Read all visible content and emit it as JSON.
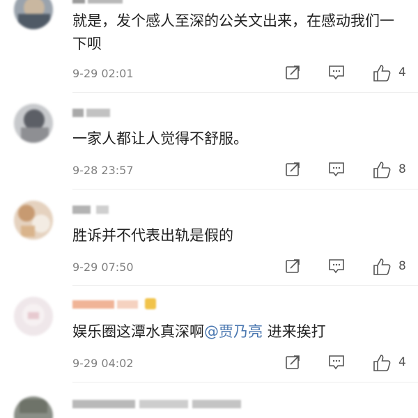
{
  "comments": [
    {
      "text": "就是，发个感人至深的公关文出来，在感动我们一下呗",
      "mention": "",
      "after": "",
      "time": "9-29 02:01",
      "likes": "4"
    },
    {
      "text": "一家人都让人觉得不舒服。",
      "mention": "",
      "after": "",
      "time": "9-28 23:57",
      "likes": "8"
    },
    {
      "text": "胜诉并不代表出轨是假的",
      "mention": "",
      "after": "",
      "time": "9-29 07:50",
      "likes": "8"
    },
    {
      "text": "娱乐圈这潭水真深啊",
      "mention": "@贾乃亮",
      "after": " 进来挨打",
      "time": "9-29 04:02",
      "likes": "4"
    }
  ],
  "icons": {
    "share": "share-icon",
    "reply": "comment-icon",
    "like": "thumbs-up-icon"
  },
  "colors": {
    "text": "#222222",
    "meta": "#808080",
    "mention": "#4a77b0",
    "icon": "#555555"
  }
}
